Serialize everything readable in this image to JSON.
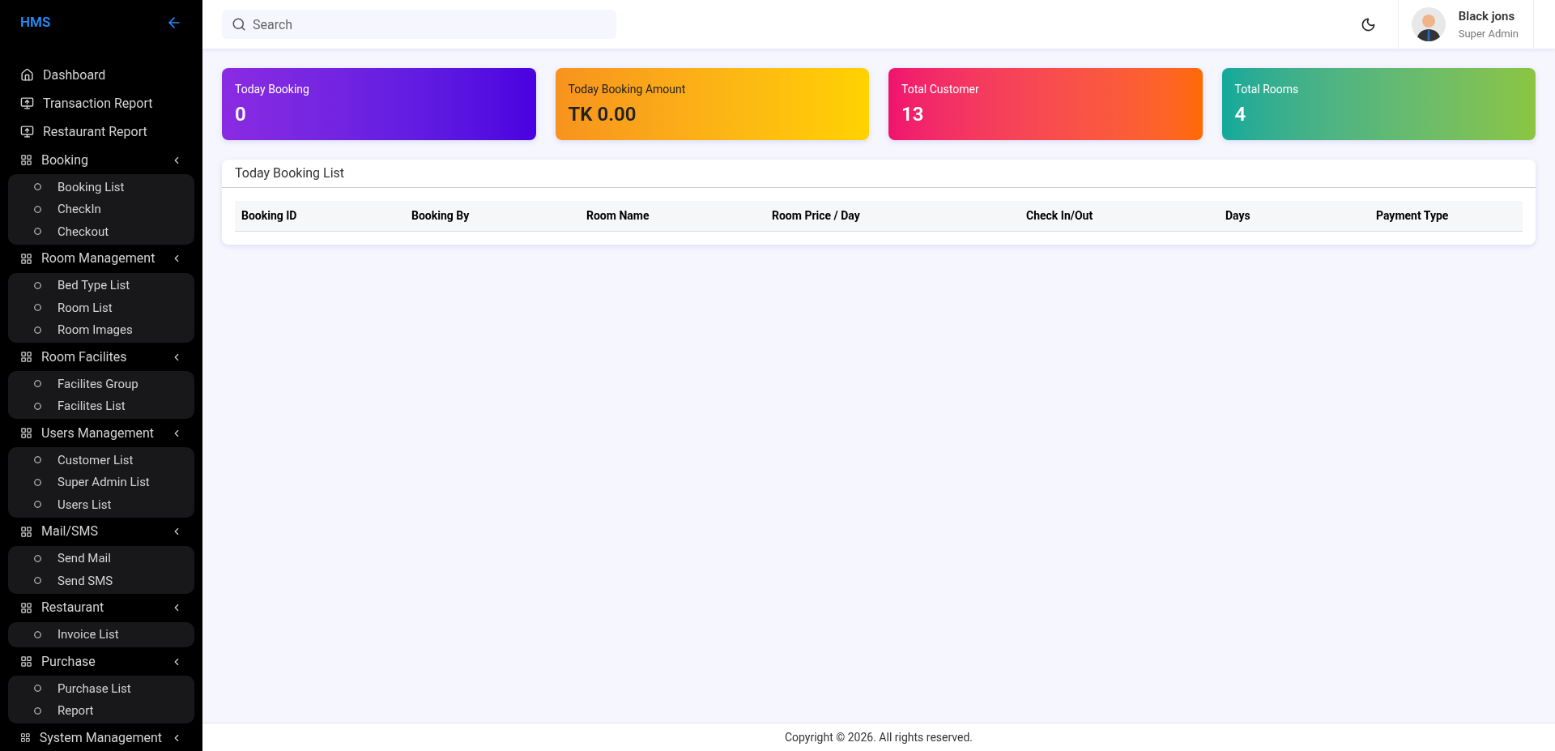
{
  "sidebar": {
    "logo": "HMS",
    "items": [
      {
        "kind": "home",
        "label": "Dashboard"
      },
      {
        "kind": "report",
        "label": "Transaction Report"
      },
      {
        "kind": "report",
        "label": "Restaurant Report"
      },
      {
        "kind": "group",
        "label": "Booking",
        "children": [
          "Booking List",
          "CheckIn",
          "Checkout"
        ]
      },
      {
        "kind": "group",
        "label": "Room Management",
        "children": [
          "Bed Type List",
          "Room List",
          "Room Images"
        ]
      },
      {
        "kind": "group",
        "label": "Room Facilites",
        "children": [
          "Facilites Group",
          "Facilites List"
        ]
      },
      {
        "kind": "group",
        "label": "Users Management",
        "children": [
          "Customer List",
          "Super Admin List",
          "Users List"
        ]
      },
      {
        "kind": "group",
        "label": "Mail/SMS",
        "children": [
          "Send Mail",
          "Send SMS"
        ]
      },
      {
        "kind": "group",
        "label": "Restaurant",
        "children": [
          "Invoice List"
        ]
      },
      {
        "kind": "group",
        "label": "Purchase",
        "children": [
          "Purchase List",
          "Report"
        ]
      },
      {
        "kind": "group",
        "label": "System Management"
      }
    ]
  },
  "header": {
    "search": {
      "placeholder": "Search"
    },
    "user": {
      "name": "Black jons",
      "role": "Super Admin"
    }
  },
  "stats": [
    {
      "label": "Today Booking",
      "value": "0"
    },
    {
      "label": "Today Booking Amount",
      "value": "TK 0.00"
    },
    {
      "label": "Total Customer",
      "value": "13"
    },
    {
      "label": "Total Rooms",
      "value": "4"
    }
  ],
  "table": {
    "title": "Today Booking List",
    "columns": [
      "Booking ID",
      "Booking By",
      "Room Name",
      "Room Price / Day",
      "Check In/Out",
      "Days",
      "Payment Type"
    ]
  },
  "footer": "Copyright © 2026. All rights reserved."
}
